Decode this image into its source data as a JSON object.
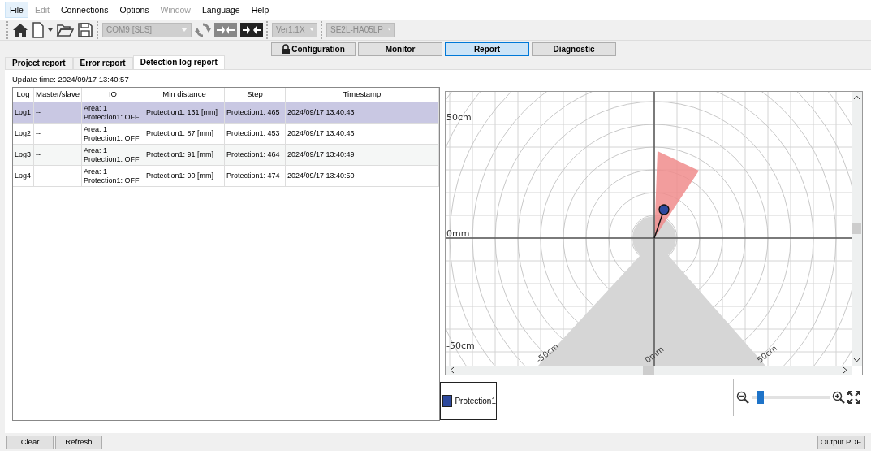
{
  "menu": [
    {
      "label": "File",
      "selected": true,
      "disabled": false
    },
    {
      "label": "Edit",
      "selected": false,
      "disabled": true
    },
    {
      "label": "Connections",
      "selected": false,
      "disabled": false
    },
    {
      "label": "Options",
      "selected": false,
      "disabled": false
    },
    {
      "label": "Window",
      "selected": false,
      "disabled": true
    },
    {
      "label": "Language",
      "selected": false,
      "disabled": false
    },
    {
      "label": "Help",
      "selected": false,
      "disabled": false
    }
  ],
  "toolbar": {
    "port_combo": {
      "value": "COM9 [SLS]",
      "disabled": true
    },
    "version_combo": {
      "value": "Ver1.1X",
      "disabled": true
    },
    "model_combo": {
      "value": "SE2L-HA05LP",
      "disabled": true
    }
  },
  "mode_buttons": [
    {
      "label": "Configuration",
      "locked": true,
      "selected": false
    },
    {
      "label": "Monitor",
      "locked": false,
      "selected": false
    },
    {
      "label": "Report",
      "locked": false,
      "selected": true
    },
    {
      "label": "Diagnostic",
      "locked": false,
      "selected": false
    }
  ],
  "tabs": [
    {
      "label": "Project report",
      "selected": false
    },
    {
      "label": "Error report",
      "selected": false
    },
    {
      "label": "Detection log report",
      "selected": true
    }
  ],
  "update_time": "Update time: 2024/09/17 13:40:57",
  "table": {
    "columns": [
      "Log",
      "Master/slave",
      "IO",
      "Min distance",
      "Step",
      "Timestamp"
    ],
    "rows": [
      {
        "selected": true,
        "log": "Log1",
        "master_slave": "--",
        "io": [
          "Area: 1",
          "Protection1: OFF"
        ],
        "min_distance": "Protection1: 131 [mm]",
        "step": "Protection1: 465",
        "timestamp": "2024/09/17 13:40:43"
      },
      {
        "selected": false,
        "log": "Log2",
        "master_slave": "--",
        "io": [
          "Area: 1",
          "Protection1: OFF"
        ],
        "min_distance": "Protection1: 87 [mm]",
        "step": "Protection1: 453",
        "timestamp": "2024/09/17 13:40:46"
      },
      {
        "selected": false,
        "log": "Log3",
        "master_slave": "--",
        "io": [
          "Area: 1",
          "Protection1: OFF"
        ],
        "min_distance": "Protection1: 91 [mm]",
        "step": "Protection1: 464",
        "timestamp": "2024/09/17 13:40:49"
      },
      {
        "selected": false,
        "log": "Log4",
        "master_slave": "--",
        "io": [
          "Area: 1",
          "Protection1: OFF"
        ],
        "min_distance": "Protection1: 90 [mm]",
        "step": "Protection1: 474",
        "timestamp": "2024/09/17 13:40:50"
      }
    ]
  },
  "plot": {
    "y_labels": [
      "50cm",
      "0mm",
      "-50cm"
    ],
    "x_labels": [
      "-50cm",
      "0mm",
      "50cm"
    ]
  },
  "legend": [
    {
      "label": "Protection1",
      "color": "#2e4a9e"
    }
  ],
  "zoom": {
    "level": 0.08
  },
  "bottom_buttons": [
    "Clear",
    "Refresh"
  ],
  "output_button": "Output PDF"
}
